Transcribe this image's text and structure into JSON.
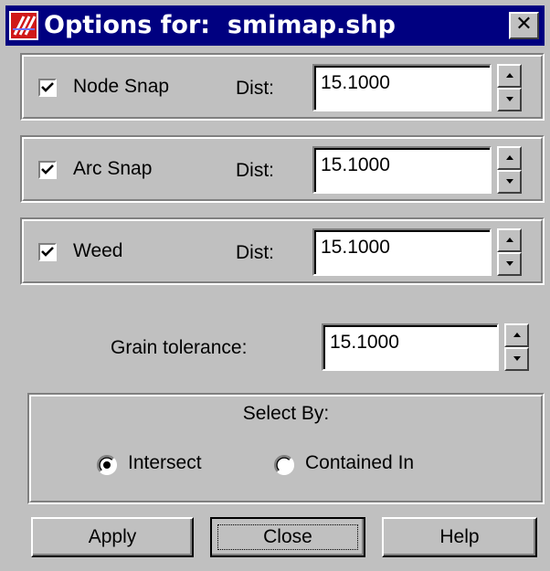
{
  "window": {
    "title": "Options for:  smimap.shp",
    "close_glyph": "✕",
    "title_bar_color": "#000080",
    "app_icon": "arcview-icon"
  },
  "snap_rows": [
    {
      "checkbox_label": "Node Snap",
      "checked": true,
      "dist_label": "Dist:",
      "value": "15.1000"
    },
    {
      "checkbox_label": "Arc Snap",
      "checked": true,
      "dist_label": "Dist:",
      "value": "15.1000"
    },
    {
      "checkbox_label": "Weed",
      "checked": true,
      "dist_label": "Dist:",
      "value": "15.1000"
    }
  ],
  "grain": {
    "label": "Grain tolerance:",
    "value": "15.1000"
  },
  "select_by": {
    "title": "Select By:",
    "options": [
      {
        "label": "Intersect",
        "selected": true
      },
      {
        "label": "Contained In",
        "selected": false
      }
    ]
  },
  "buttons": {
    "apply": "Apply",
    "close": "Close",
    "help": "Help"
  }
}
